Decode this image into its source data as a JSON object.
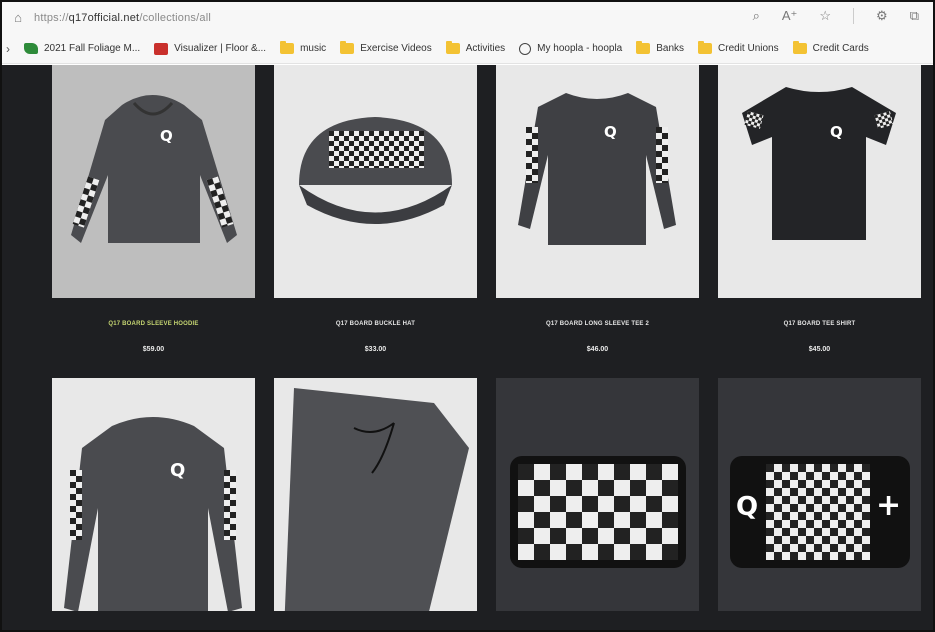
{
  "browser": {
    "url_prefix": "https://",
    "url_host": "q17official.net",
    "url_path": "/collections/all"
  },
  "bookmarks": [
    {
      "label": "2021 Fall Foliage M...",
      "icon": "leaf-icon"
    },
    {
      "label": "Visualizer | Floor &...",
      "icon": "visualizer-icon"
    },
    {
      "label": "music",
      "icon": "folder-icon"
    },
    {
      "label": "Exercise Videos",
      "icon": "folder-icon"
    },
    {
      "label": "Activities",
      "icon": "folder-icon"
    },
    {
      "label": "My hoopla - hoopla",
      "icon": "hoopla-icon"
    },
    {
      "label": "Banks",
      "icon": "folder-icon"
    },
    {
      "label": "Credit Unions",
      "icon": "folder-icon"
    },
    {
      "label": "Credit Cards",
      "icon": "folder-icon"
    }
  ],
  "products": [
    {
      "title": "Q17 BOARD SLEEVE HOODIE",
      "price": "$59.00",
      "highlighted": true
    },
    {
      "title": "Q17 BOARD BUCKLE HAT",
      "price": "$33.00",
      "highlighted": false
    },
    {
      "title": "Q17 BOARD LONG SLEEVE TEE 2",
      "price": "$46.00",
      "highlighted": false
    },
    {
      "title": "Q17 BOARD TEE SHIRT",
      "price": "$45.00",
      "highlighted": false
    },
    {
      "title": "",
      "price": "",
      "highlighted": false
    },
    {
      "title": "",
      "price": "",
      "highlighted": false
    },
    {
      "title": "",
      "price": "",
      "highlighted": false
    },
    {
      "title": "",
      "price": "",
      "highlighted": false
    }
  ],
  "logo_letter": "Q",
  "plus_sign": "+",
  "colors": {
    "page_bg": "#1e1f22",
    "highlight_title": "#c6d672",
    "folder": "#f3c233"
  }
}
